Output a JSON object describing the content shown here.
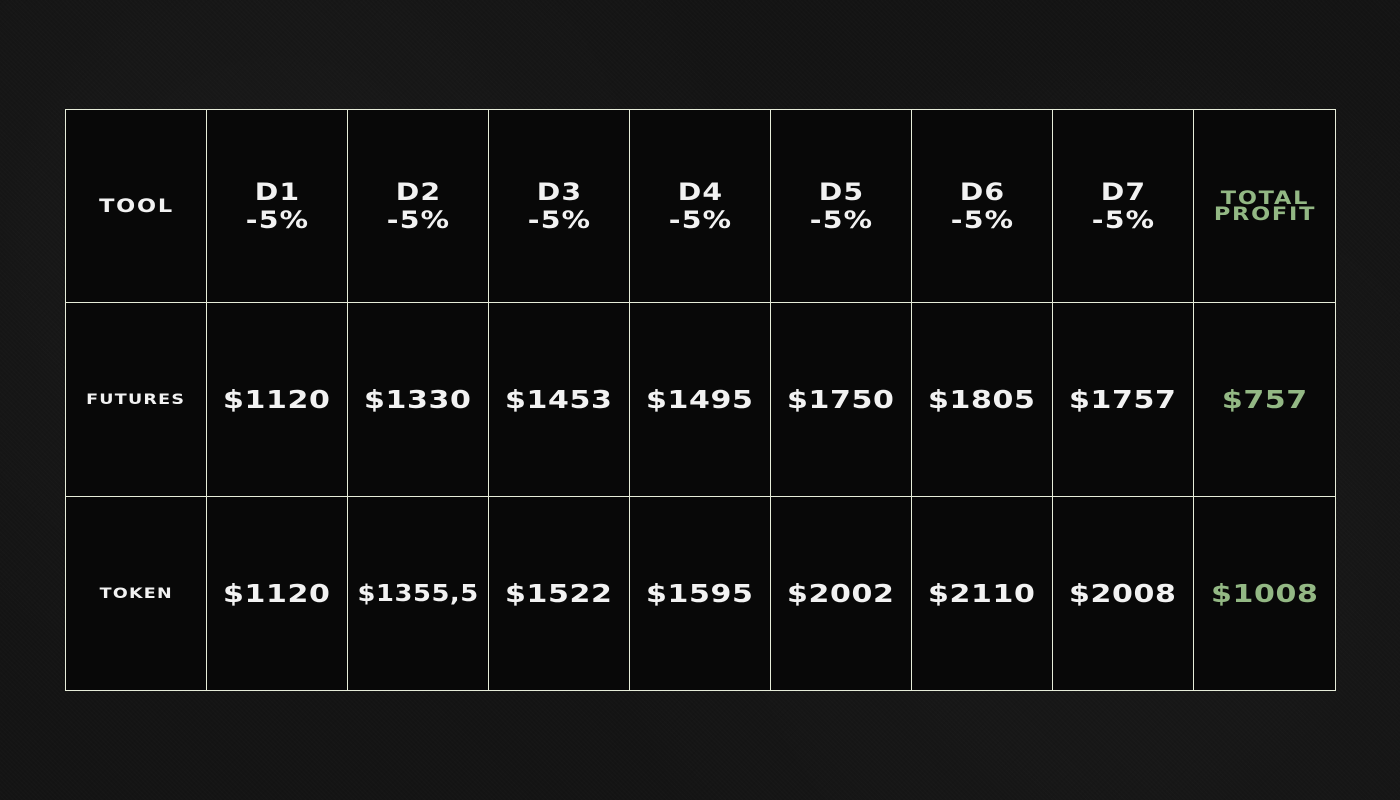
{
  "headers": {
    "tool": "TOOL",
    "days": [
      {
        "label": "D1",
        "change": "-5%"
      },
      {
        "label": "D2",
        "change": "-5%"
      },
      {
        "label": "D3",
        "change": "-5%"
      },
      {
        "label": "D4",
        "change": "-5%"
      },
      {
        "label": "D5",
        "change": "-5%"
      },
      {
        "label": "D6",
        "change": "-5%"
      },
      {
        "label": "D7",
        "change": "-5%"
      }
    ],
    "total_line1": "TOTAL",
    "total_line2": "PROFIT"
  },
  "rows": [
    {
      "label": "FUTURES",
      "values": [
        "$1120",
        "$1330",
        "$1453",
        "$1495",
        "$1750",
        "$1805",
        "$1757"
      ],
      "total": "$757"
    },
    {
      "label": "TOKEN",
      "values": [
        "$1120",
        "$1355,5",
        "$1522",
        "$1595",
        "$2002",
        "$2110",
        "$2008"
      ],
      "total": "$1008"
    }
  ],
  "colors": {
    "background": "#141414",
    "table_bg": "#080808",
    "border": "#e6ecd9",
    "text": "#f2f2f2",
    "accent_green": "#93b884"
  }
}
